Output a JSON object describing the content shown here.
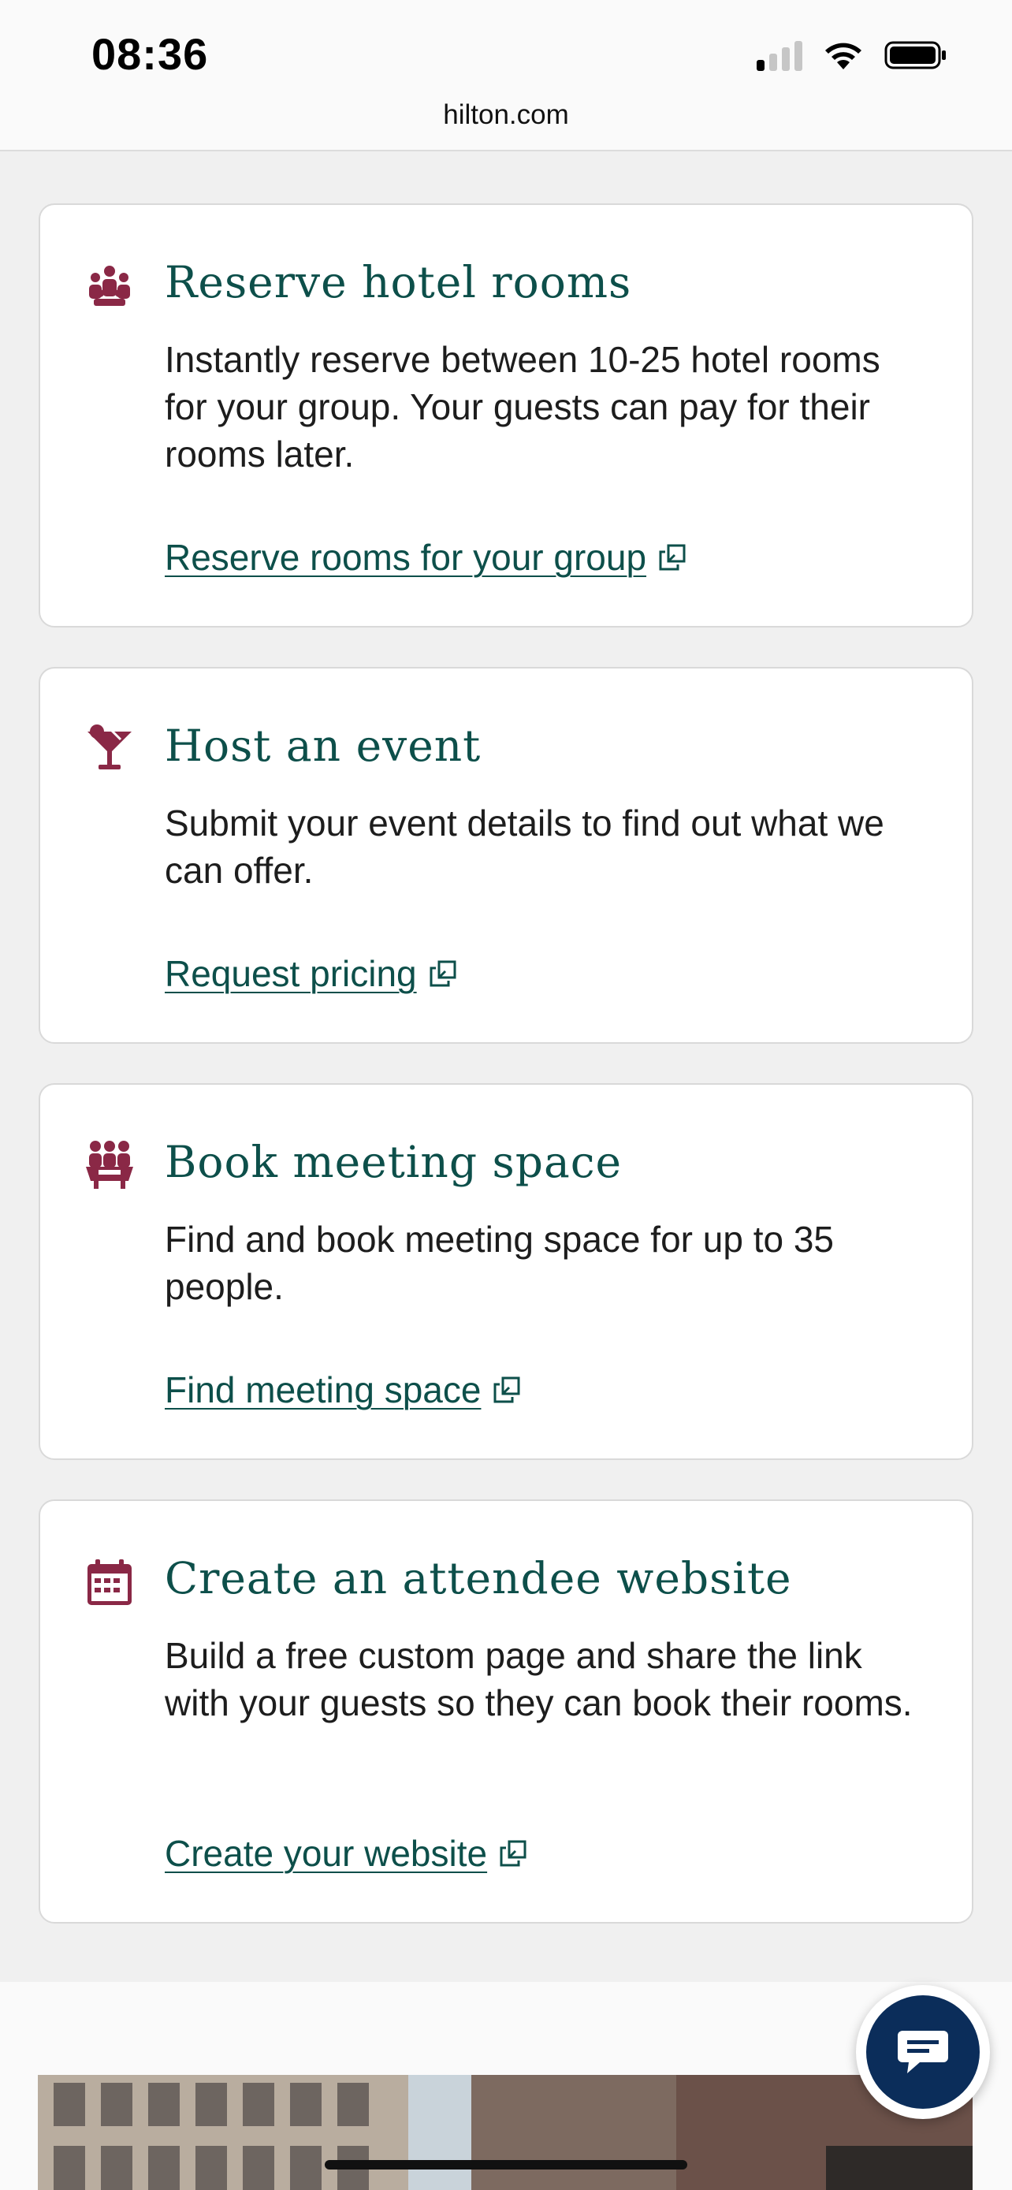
{
  "status_bar": {
    "time": "08:36"
  },
  "browser": {
    "url": "hilton.com"
  },
  "accent_colors": {
    "icon": "#8a2846",
    "heading": "#0d4f4a",
    "chat_button": "#0b2d5a"
  },
  "cards": [
    {
      "icon": "group-people-icon",
      "title": "Reserve hotel rooms",
      "description": "Instantly reserve between 10-25 hotel rooms for your group. Your guests can pay for their rooms later.",
      "link": "Reserve rooms for your group"
    },
    {
      "icon": "cocktail-icon",
      "title": "Host an event",
      "description": "Submit your event details to find out what we can offer.",
      "link": "Request pricing"
    },
    {
      "icon": "meeting-people-icon",
      "title": "Book meeting space",
      "description": "Find and book meeting space for up to 35 people.",
      "link": "Find meeting space"
    },
    {
      "icon": "calendar-icon",
      "title": "Create an attendee website",
      "description": "Build a free custom page and share the link with your guests so they can book their rooms.",
      "link": "Create your website"
    }
  ],
  "chat": {
    "icon": "chat-bubble-icon"
  }
}
